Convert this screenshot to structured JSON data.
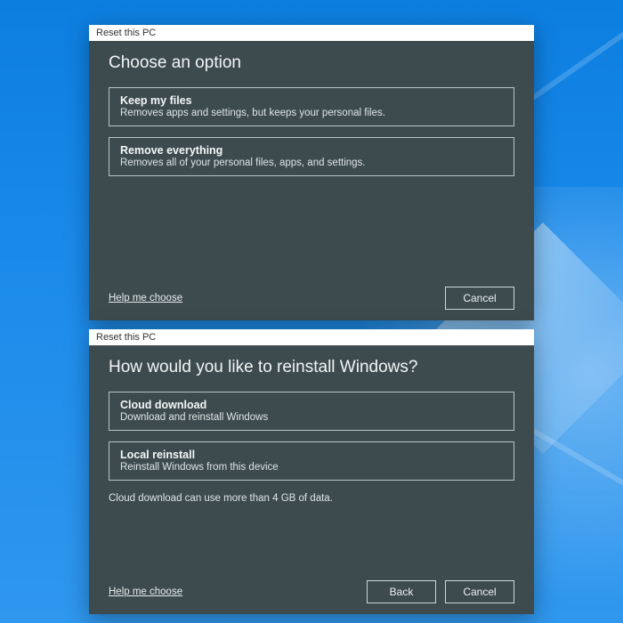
{
  "dialog1": {
    "titlebar": "Reset this PC",
    "heading": "Choose an option",
    "options": [
      {
        "title": "Keep my files",
        "desc": "Removes apps and settings, but keeps your personal files."
      },
      {
        "title": "Remove everything",
        "desc": "Removes all of your personal files, apps, and settings."
      }
    ],
    "help_link": "Help me choose",
    "buttons": {
      "cancel": "Cancel"
    }
  },
  "dialog2": {
    "titlebar": "Reset this PC",
    "heading": "How would you like to reinstall Windows?",
    "options": [
      {
        "title": "Cloud download",
        "desc": "Download and reinstall Windows"
      },
      {
        "title": "Local reinstall",
        "desc": "Reinstall Windows from this device"
      }
    ],
    "note": "Cloud download can use more than 4 GB of data.",
    "help_link": "Help me choose",
    "buttons": {
      "back": "Back",
      "cancel": "Cancel"
    }
  }
}
